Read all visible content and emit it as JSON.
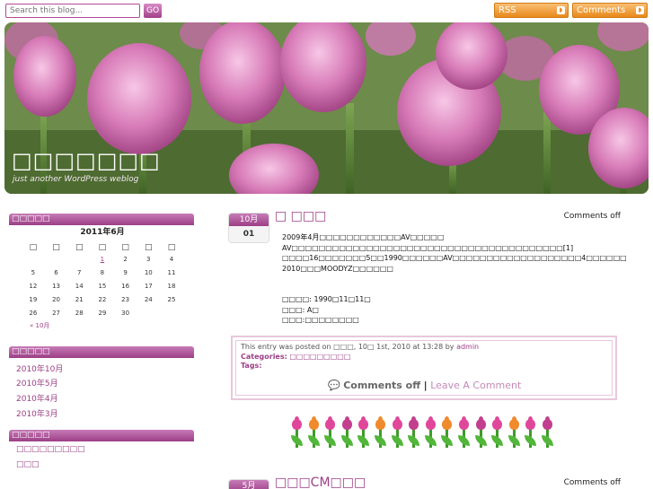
{
  "search": {
    "placeholder": "Search this blog...",
    "button_label": "GO"
  },
  "feeds": {
    "rss_label": "RSS",
    "comments_label": "Comments"
  },
  "header": {
    "title": "□□□□□□□",
    "tagline": "just another WordPress weblog"
  },
  "sidebar": {
    "calendar_heading": "□□□□□",
    "calendar": {
      "caption": "2011年6月",
      "weekdays": [
        "□",
        "□",
        "□",
        "□",
        "□",
        "□",
        "□"
      ],
      "weeks": [
        [
          "",
          "",
          "",
          "1",
          "2",
          "3",
          "4"
        ],
        [
          "5",
          "6",
          "7",
          "8",
          "9",
          "10",
          "11"
        ],
        [
          "12",
          "13",
          "14",
          "15",
          "16",
          "17",
          "18"
        ],
        [
          "19",
          "20",
          "21",
          "22",
          "23",
          "24",
          "25"
        ],
        [
          "26",
          "27",
          "28",
          "29",
          "30",
          "",
          ""
        ]
      ],
      "linked_day": "1",
      "prev_link": "« 10月"
    },
    "archives_heading": "□□□□□",
    "archives": [
      "2010年10月",
      "2010年5月",
      "2010年4月",
      "2010年3月"
    ],
    "categories_heading": "□□□□□",
    "categories": [
      "□□□□□□□□□",
      "□□□"
    ]
  },
  "posts": [
    {
      "month": "10月",
      "day": "01",
      "title": "□ □□□",
      "comments_status": "Comments off",
      "body": [
        "2009年4月□□□□□□□□□□□□AV□□□□□",
        "AV□□□□□□□□□□□□□□□□□□□□□□□□□□□□□□□□□□□□□□□□[1]",
        "□□□□16□□□□□□□5□□1990□□□□□□AV□□□□□□□□□□□□□□□□□□□4□□□□□□",
        "2010□□□MOODYZ□□□□□□",
        "",
        "",
        "□□□□: 1990□11□11□",
        "□□□: A□",
        "□□□:□□□□□□□□"
      ],
      "meta": {
        "posted_prefix": "This entry was posted on",
        "date_text": "□□□, 10□ 1st, 2010",
        "at_text": "at 13:28 by",
        "author": "admin",
        "categories_label": "Categories:",
        "categories_value": "□□□□□□□□□",
        "tags_label": "Tags:",
        "comments_off_link": "Comments off",
        "separator": "|",
        "leave_comment": "Leave A Comment"
      }
    },
    {
      "month": "5月",
      "title": "□□□CM□□□",
      "comments_status": "Comments off"
    }
  ],
  "colors": {
    "accent": "#9c3f86",
    "feed_orange": "#e9881a",
    "meta_border": "#e8c7dc"
  },
  "icons": [
    "rss-icon",
    "comment-icon",
    "tulip-decoration"
  ]
}
